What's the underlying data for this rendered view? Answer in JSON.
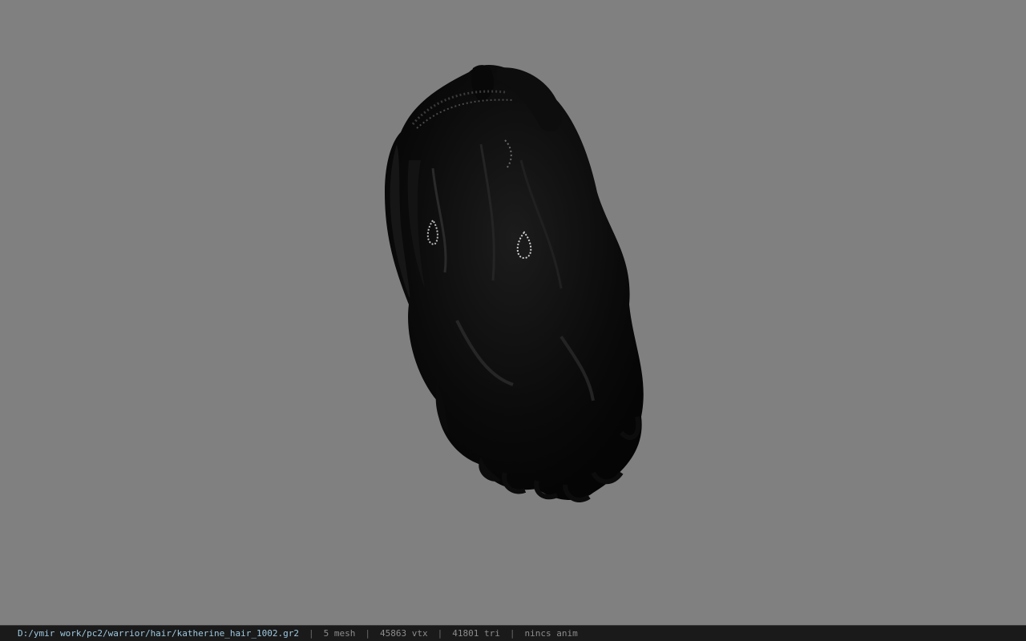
{
  "viewer": {
    "background_color": "#808080",
    "model_icon": "hair-mesh-icon"
  },
  "statusbar": {
    "file_path": "D:/ymir work/pc2/warrior/hair/katherine_hair_1002.gr2",
    "separator": "|",
    "mesh_count": "5 mesh",
    "vertex_count": "45863 vtx",
    "triangle_count": "41801 tri",
    "animation_status": "nincs anim",
    "path_color": "#9ec9e0"
  }
}
